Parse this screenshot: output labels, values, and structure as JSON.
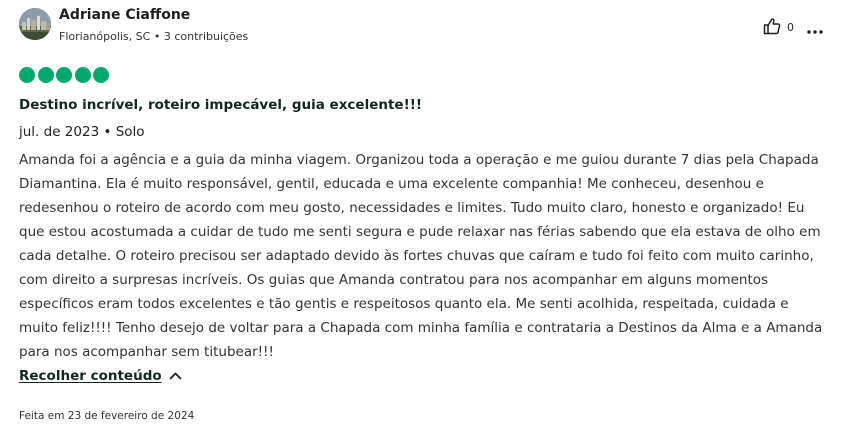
{
  "review": {
    "user": {
      "name": "Adriane Ciaffone",
      "location": "Florianópolis, SC",
      "separator": "•",
      "contributions": "3 contribuições"
    },
    "helpful_count": "0",
    "rating": {
      "value": 5,
      "max": 5,
      "bubble_color": "#00aa6c"
    },
    "title": "Destino incrível, roteiro impecável, guia excelente!!!",
    "trip_info": "jul. de 2023 • Solo",
    "text": "Amanda foi a agência e a guia da minha viagem. Organizou toda a operação e me guiou durante 7 dias pela Chapada Diamantina. Ela é muito responsável, gentil, educada e uma excelente companhia! Me conheceu, desenhou e redesenhou o roteiro de acordo com meu gosto, necessidades e limites. Tudo muito claro, honesto e organizado! Eu que estou acostumada a cuidar de tudo me senti segura e pude relaxar nas férias sabendo que ela estava de olho em cada detalhe. O roteiro precisou ser adaptado devido às fortes chuvas que caíram e tudo foi feito com muito carinho, com direito a surpresas incríveis. Os guias que Amanda contratou para nos acompanhar em alguns momentos específicos eram todos excelentes e tão gentis e respeitosos quanto ela. Me senti acolhida, respeitada, cuidada e muito feliz!!!! Tenho desejo de voltar para a Chapada com minha família e contrataria a Destinos da Alma e a Amanda para nos acompanhar sem titubear!!!",
    "collapse_label": "Recolher conteúdo",
    "written_date": "Feita em 23 de fevereiro de 2024"
  },
  "icons": {
    "helpful": "thumbs-up-icon",
    "more": "more-horizontal-icon",
    "collapse": "chevron-up-icon"
  },
  "colors": {
    "accent_green": "#00aa6c",
    "title_dark": "#0f2a1c",
    "text": "#333333"
  }
}
